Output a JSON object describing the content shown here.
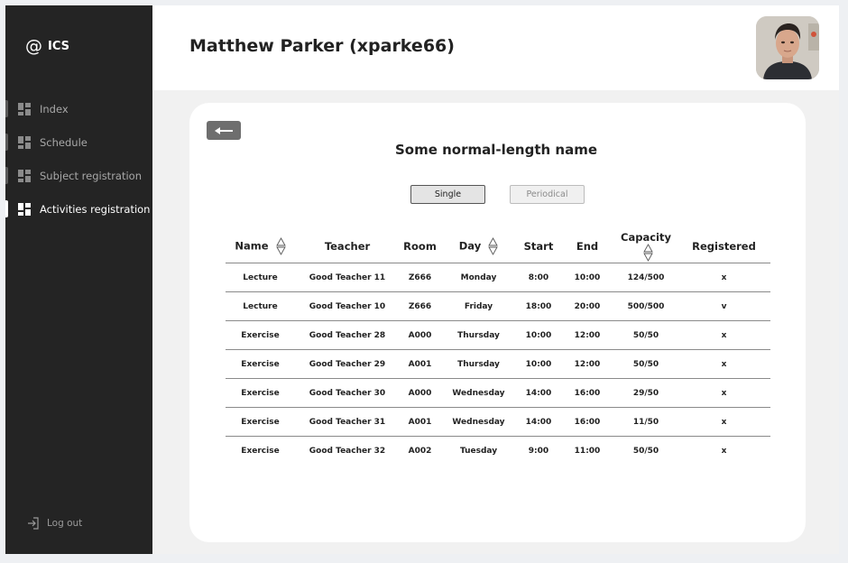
{
  "sidebar": {
    "brand": {
      "symbol": "@",
      "name": "ICS"
    },
    "items": [
      {
        "label": "Index",
        "icon": "dashboard-icon",
        "active": false
      },
      {
        "label": "Schedule",
        "icon": "dashboard-icon",
        "active": false
      },
      {
        "label": "Subject registration",
        "icon": "dashboard-icon",
        "active": false
      },
      {
        "label": "Activities registration",
        "icon": "dashboard-icon",
        "active": true
      }
    ],
    "logout_label": "Log out"
  },
  "header": {
    "user_title": "Matthew Parker (xparke66)"
  },
  "card": {
    "title": "Some normal-length name",
    "mode_single": "Single",
    "mode_periodical": "Periodical"
  },
  "table": {
    "columns": [
      "Name",
      "Teacher",
      "Room",
      "Day",
      "Start",
      "End",
      "Capacity",
      "Registered"
    ],
    "rows": [
      [
        "Lecture",
        "Good Teacher 11",
        "Z666",
        "Monday",
        "8:00",
        "10:00",
        "124/500",
        "x"
      ],
      [
        "Lecture",
        "Good Teacher 10",
        "Z666",
        "Friday",
        "18:00",
        "20:00",
        "500/500",
        "v"
      ],
      [
        "Exercise",
        "Good Teacher 28",
        "A000",
        "Thursday",
        "10:00",
        "12:00",
        "50/50",
        "x"
      ],
      [
        "Exercise",
        "Good Teacher 29",
        "A001",
        "Thursday",
        "10:00",
        "12:00",
        "50/50",
        "x"
      ],
      [
        "Exercise",
        "Good Teacher 30",
        "A000",
        "Wednesday",
        "14:00",
        "16:00",
        "29/50",
        "x"
      ],
      [
        "Exercise",
        "Good Teacher 31",
        "A001",
        "Wednesday",
        "14:00",
        "16:00",
        "11/50",
        "x"
      ],
      [
        "Exercise",
        "Good Teacher 32",
        "A002",
        "Tuesday",
        "9:00",
        "11:00",
        "50/50",
        "x"
      ]
    ]
  },
  "colors": {
    "sidebar_bg": "#242424",
    "page_bg": "#f1f1f1",
    "back_button": "#6e6e6e"
  }
}
